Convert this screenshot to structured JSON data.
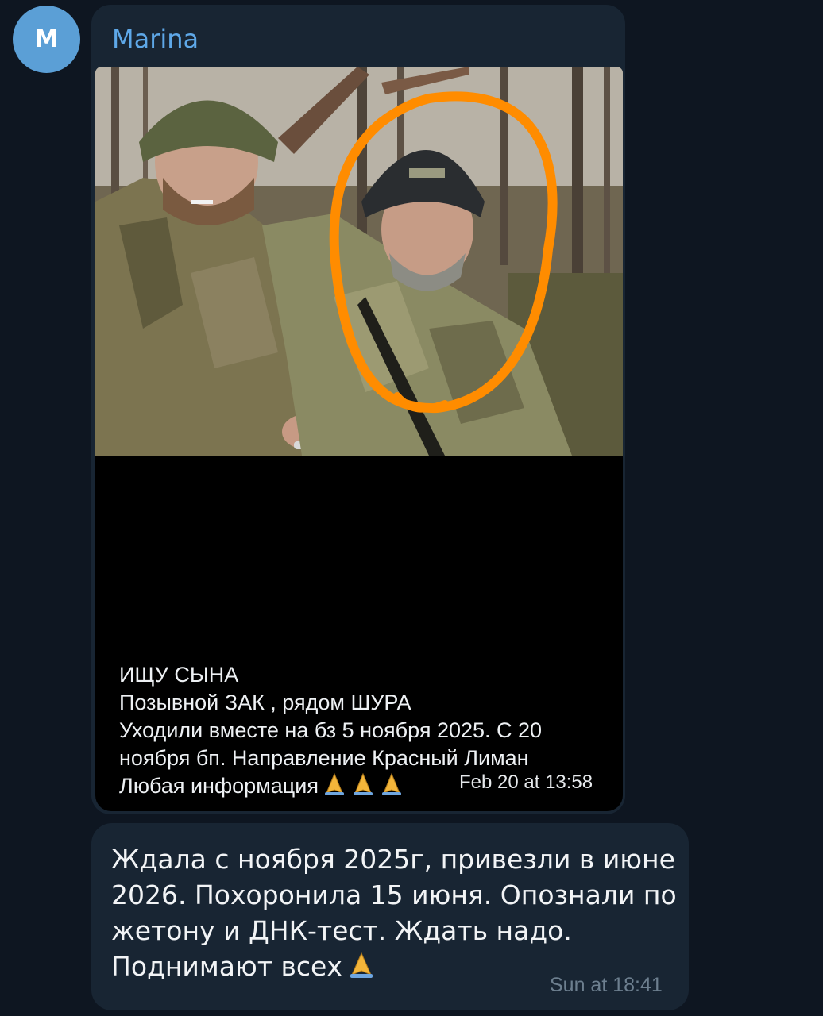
{
  "sender": {
    "avatar_letter": "M",
    "name": "Marina"
  },
  "message1": {
    "caption_lines": [
      "ИЩУ СЫНА",
      "Позывной ЗАК , рядом ШУРА",
      "Уходили вместе на бз 5 ноября 2025. С 20",
      "ноября бп. Направление Красный Лиман",
      "Любая информация"
    ],
    "timestamp": "Feb 20 at 13:58",
    "emoji": "praying-hands-icon"
  },
  "message2": {
    "lines": [
      "Ждала с ноября 2025г, привезли в июне",
      "2026. Похоронила 15 июня. Опознали по",
      "жетону и ДНК-тест. Ждать надо.",
      "Поднимают всех"
    ],
    "timestamp": "Sun at 18:41",
    "emoji": "praying-hands-icon"
  },
  "colors": {
    "background": "#0e1621",
    "bubble": "#182533",
    "sender_name": "#5ea8e8",
    "avatar": "#5b9fd6",
    "highlight_circle": "#ff8c00"
  }
}
